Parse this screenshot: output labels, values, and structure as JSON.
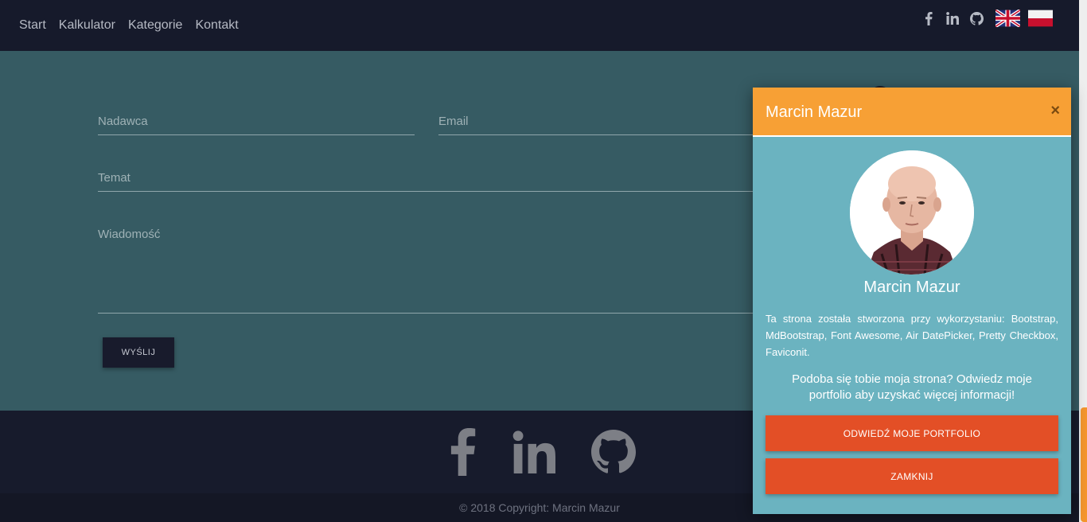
{
  "nav": {
    "links": [
      "Start",
      "Kalkulator",
      "Kategorie",
      "Kontakt"
    ],
    "icons": [
      "facebook-icon",
      "linkedin-icon",
      "github-icon"
    ],
    "flags": [
      "uk-flag",
      "pl-flag"
    ]
  },
  "form": {
    "sender_label": "Nadawca",
    "email_label": "Email",
    "subject_label": "Temat",
    "message_label": "Wiadomość",
    "send_label": "WYŚLIJ"
  },
  "footer": {
    "icons": [
      "facebook-icon",
      "linkedin-icon",
      "github-icon"
    ],
    "copyright": "© 2018 Copyright: Marcin Mazur"
  },
  "modal": {
    "title": "Marcin Mazur",
    "close": "×",
    "name": "Marcin Mazur",
    "description": "Ta strona została stworzona przy wykorzystaniu: Bootstrap, MdBootstrap, Font Awesome, Air DatePicker, Pretty Checkbox, Faviconit.",
    "cta": "Podoba się tobie moja strona? Odwiedz moje portfolio aby uzyskać więcej informacji!",
    "portfolio_button": "ODWIEDŹ MOJE PORTFOLIO",
    "close_button": "ZAMKNIJ"
  },
  "colors": {
    "navbar": "#161a2b",
    "main": "#365b63",
    "modal_header": "#f7a035",
    "modal_body": "#6bb3c0",
    "button": "#e34f26"
  }
}
